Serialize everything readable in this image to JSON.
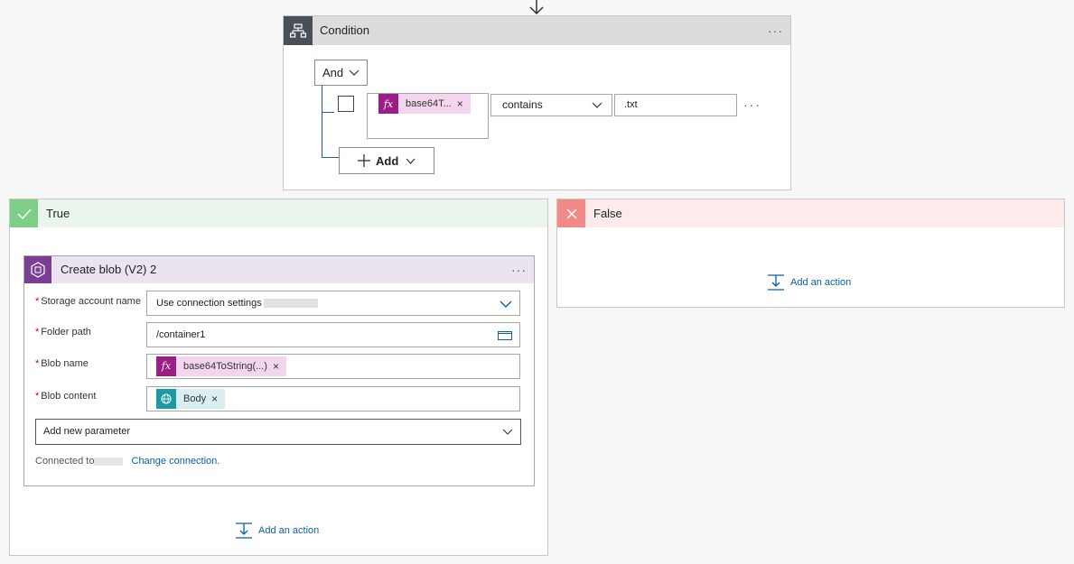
{
  "condition": {
    "title": "Condition",
    "operator_group": "And",
    "row": {
      "token_label": "base64T...",
      "token_icon": "fx-expression-icon",
      "operator": "contains",
      "value": ".txt"
    },
    "add_label": "Add"
  },
  "true_branch": {
    "title": "True",
    "action": {
      "title": "Create blob (V2) 2",
      "fields": [
        {
          "label": "Storage account name",
          "value": "Use connection settings"
        },
        {
          "label": "Folder path",
          "value": "/container1"
        },
        {
          "label": "Blob name",
          "token": "base64ToString(...)"
        },
        {
          "label": "Blob content",
          "token": "Body"
        }
      ],
      "add_param_label": "Add new parameter",
      "connected_prefix": "Connected to",
      "change_connection": "Change connection."
    },
    "add_action_label": "Add an action"
  },
  "false_branch": {
    "title": "False",
    "add_action_label": "Add an action"
  },
  "colors": {
    "condition_header": "#dcdcdc",
    "true_header": "#eaf6ec",
    "false_header": "#fdeaea",
    "fx_token": "#9d1d86",
    "link": "#0a5fa8"
  }
}
